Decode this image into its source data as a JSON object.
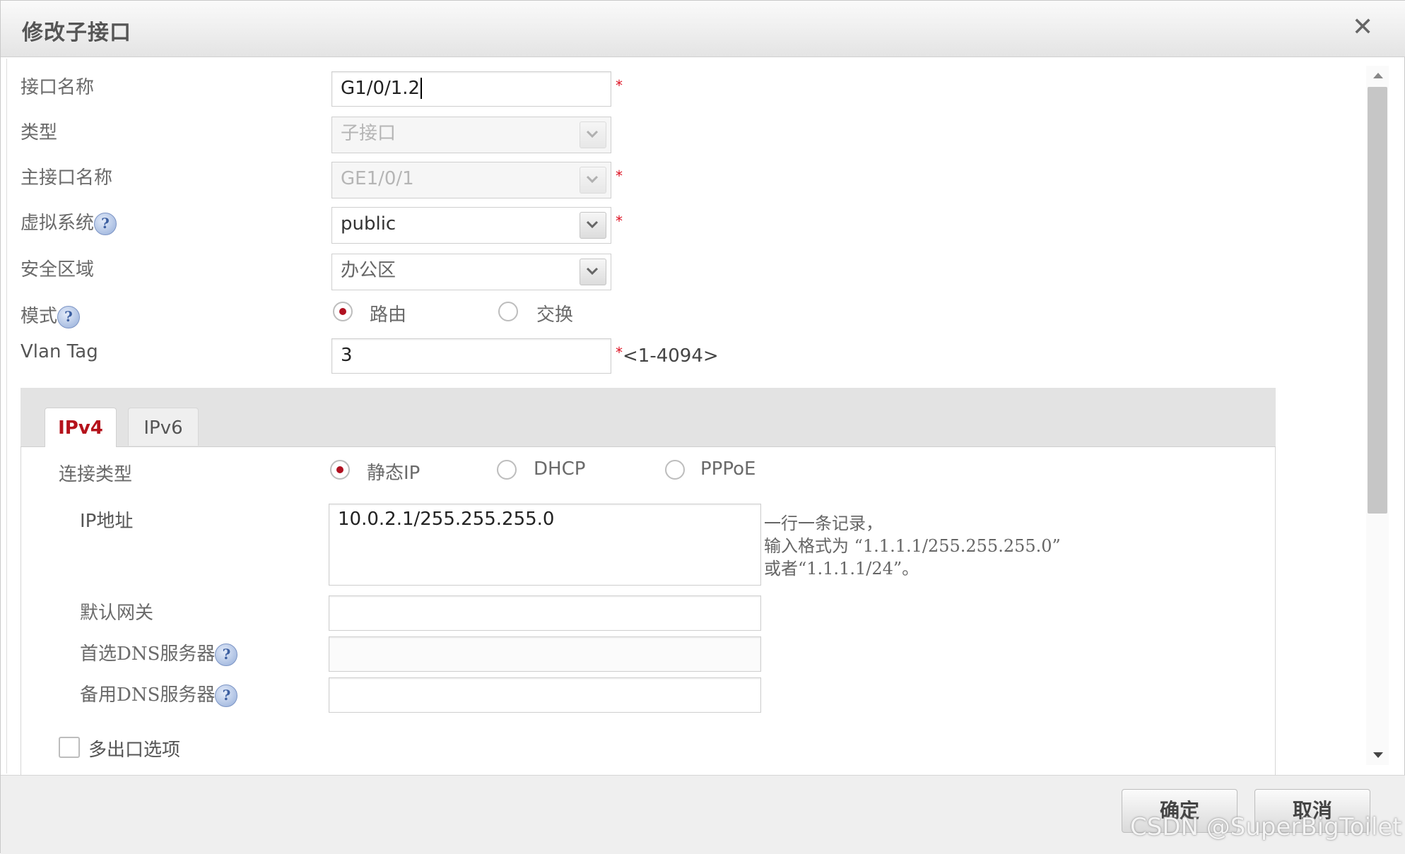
{
  "dialog": {
    "title": "修改子接口",
    "close_glyph": "✕"
  },
  "form": {
    "interface_name": {
      "label": "接口名称",
      "value": "G1/0/1.2",
      "required": "*"
    },
    "type": {
      "label": "类型",
      "value": "子接口"
    },
    "main_interface": {
      "label": "主接口名称",
      "value": "GE1/0/1",
      "required": "*"
    },
    "virtual_system": {
      "label": "虚拟系统",
      "value": "public",
      "required": "*",
      "help": "?"
    },
    "security_zone": {
      "label": "安全区域",
      "value": "办公区"
    },
    "mode": {
      "label": "模式",
      "help": "?",
      "options": [
        "路由",
        "交换"
      ],
      "selected": "路由"
    },
    "vlan_tag": {
      "label": "Vlan Tag",
      "value": "3",
      "required": "*",
      "range_hint": "<1-4094>"
    }
  },
  "tabs": [
    {
      "label": "IPv4",
      "active": true
    },
    {
      "label": "IPv6",
      "active": false
    }
  ],
  "ipv4": {
    "connection_type": {
      "label": "连接类型",
      "options": [
        "静态IP",
        "DHCP",
        "PPPoE"
      ],
      "selected": "静态IP"
    },
    "ip_address": {
      "label": "IP地址",
      "value": "10.0.2.1/255.255.255.0",
      "hint_lines": [
        "一行一条记录，",
        "输入格式为 “1.1.1.1/255.255.255.0”",
        "或者“1.1.1.1/24”。"
      ]
    },
    "default_gateway": {
      "label": "默认网关",
      "value": ""
    },
    "preferred_dns": {
      "label": "首选DNS服务器",
      "value": "",
      "help": "?"
    },
    "alternate_dns": {
      "label": "备用DNS服务器",
      "value": "",
      "help": "?"
    },
    "multi_egress": {
      "label": "多出口选项",
      "checked": false
    }
  },
  "footer": {
    "ok_label": "确定",
    "cancel_label": "取消"
  },
  "watermark": "CSDN @SuperBigToilet",
  "colors": {
    "accent_red": "#b5121b",
    "required_red": "#dd1122",
    "help_blue": "#3b5ea0"
  }
}
